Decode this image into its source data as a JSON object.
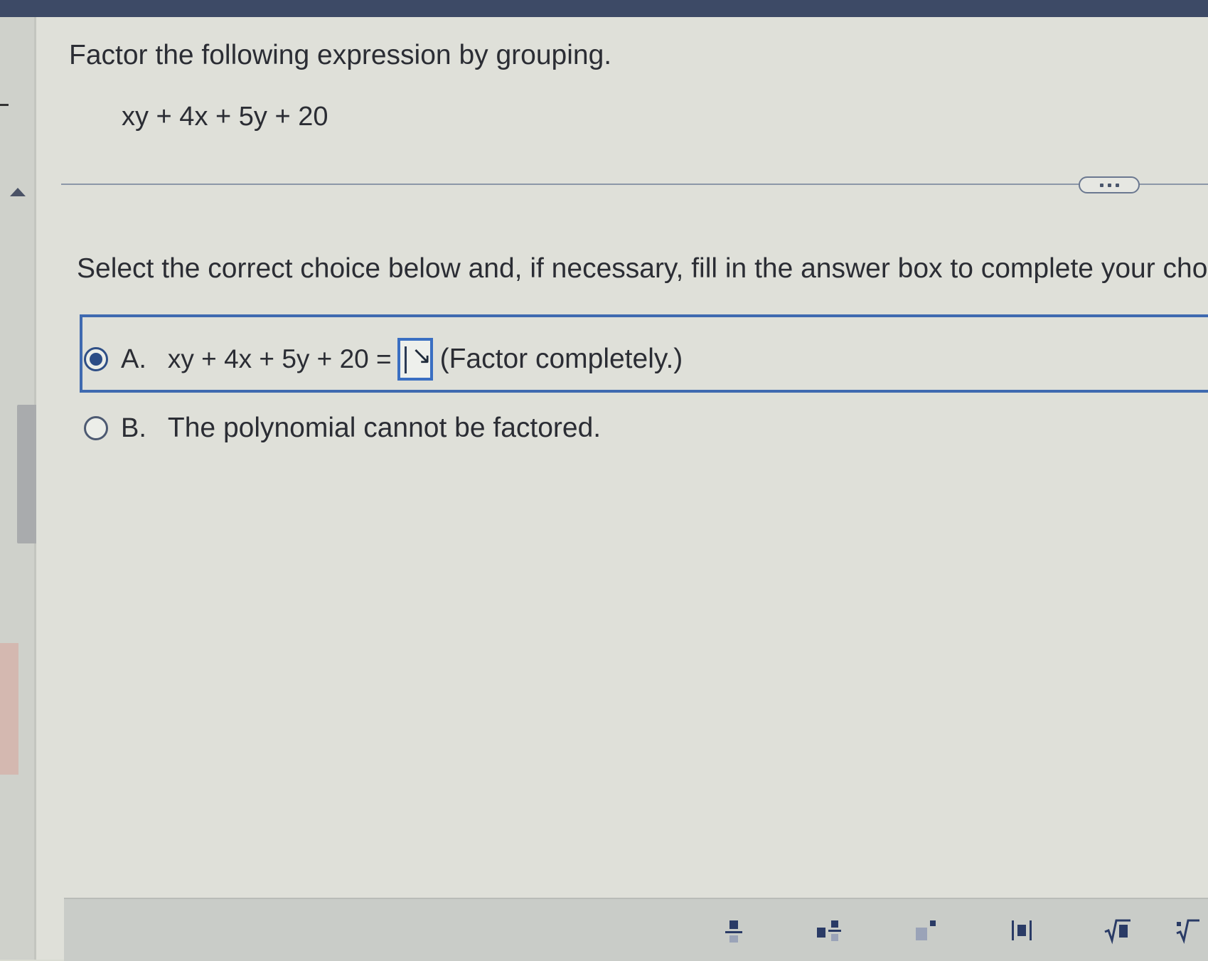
{
  "question": {
    "title": "Factor the following expression by grouping.",
    "expression": "xy + 4x + 5y + 20"
  },
  "instructions": "Select the correct choice below and, if necessary, fill in the answer box to complete your choice.",
  "choices": [
    {
      "letter": "A.",
      "lhs": "xy + 4x + 5y + 20 =",
      "answer_value": "",
      "hint": "(Factor completely.)",
      "selected": true
    },
    {
      "letter": "B.",
      "text": "The polynomial cannot be factored.",
      "selected": false
    }
  ],
  "toolbar": {
    "tools": [
      "fraction-icon",
      "mixed-number-icon",
      "exponent-icon",
      "absolute-value-icon",
      "square-root-icon",
      "nth-root-icon"
    ]
  },
  "colors": {
    "accent": "#3f6ab0",
    "header": "#3d4a66",
    "background": "#dfe0d9"
  }
}
